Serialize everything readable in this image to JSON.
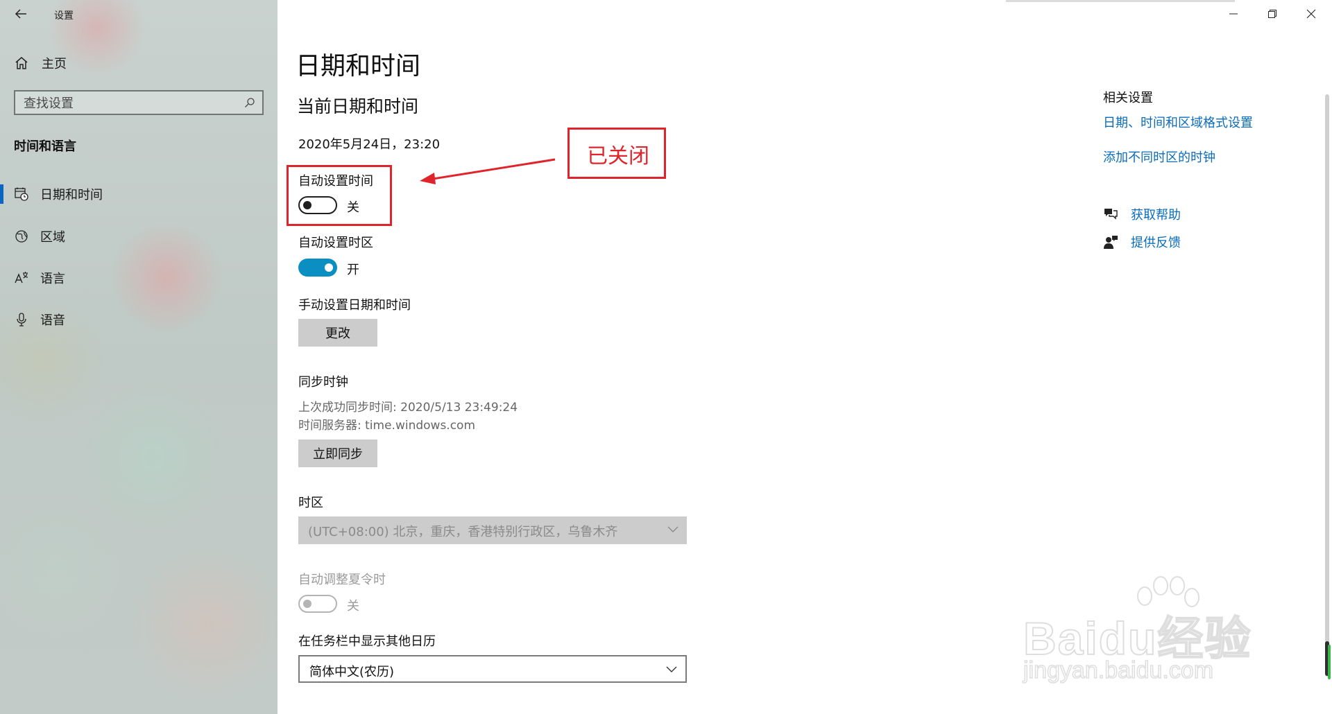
{
  "window": {
    "app_title": "设置"
  },
  "sidebar": {
    "home_label": "主页",
    "search_placeholder": "查找设置",
    "section_title": "时间和语言",
    "items": [
      {
        "label": "日期和时间",
        "icon": "calendar-clock-icon",
        "active": true
      },
      {
        "label": "区域",
        "icon": "globe-icon",
        "active": false
      },
      {
        "label": "语言",
        "icon": "language-icon",
        "active": false
      },
      {
        "label": "语音",
        "icon": "microphone-icon",
        "active": false
      }
    ]
  },
  "main": {
    "page_title": "日期和时间",
    "subtitle": "当前日期和时间",
    "current_datetime": "2020年5月24日，23:20",
    "auto_time": {
      "label": "自动设置时间",
      "state": "关",
      "on": false
    },
    "auto_timezone": {
      "label": "自动设置时区",
      "state": "开",
      "on": true
    },
    "manual": {
      "label": "手动设置日期和时间",
      "button": "更改"
    },
    "sync": {
      "label": "同步时钟",
      "last_sync": "上次成功同步时间: 2020/5/13 23:49:24",
      "server": "时间服务器: time.windows.com",
      "button": "立即同步"
    },
    "timezone": {
      "label": "时区",
      "value": "(UTC+08:00) 北京，重庆，香港特别行政区，乌鲁木齐",
      "disabled": true
    },
    "dst": {
      "label": "自动调整夏令时",
      "state": "关",
      "disabled": true
    },
    "calendar": {
      "label": "在任务栏中显示其他日历",
      "value": "简体中文(农历)"
    }
  },
  "annotation": {
    "text": "已关闭",
    "color": "#e0242b"
  },
  "related": {
    "title": "相关设置",
    "links": [
      "日期、时间和区域格式设置",
      "添加不同时区的时钟"
    ],
    "help": "获取帮助",
    "feedback": "提供反馈"
  },
  "watermark": {
    "logo": "Baidu经验",
    "url": "jingyan.baidu.com"
  },
  "colors": {
    "accent": "#0b8fc3",
    "link": "#0a6cbd",
    "annotation": "#e0242b"
  }
}
